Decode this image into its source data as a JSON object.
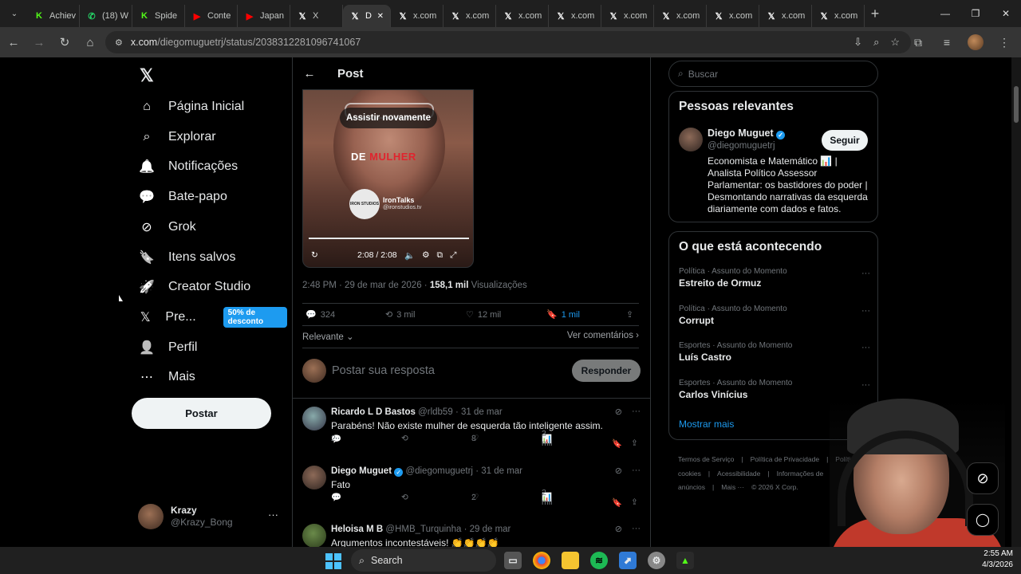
{
  "browser": {
    "tabs": [
      {
        "label": "Achiev",
        "fav": "K",
        "fav_color": "#53fc18"
      },
      {
        "label": "(18) W",
        "fav": "✆",
        "fav_color": "#25d366"
      },
      {
        "label": "Spide",
        "fav": "K",
        "fav_color": "#53fc18"
      },
      {
        "label": "Conte",
        "fav": "▶",
        "fav_color": "#ff0000"
      },
      {
        "label": "Japan",
        "fav": "▶",
        "fav_color": "#ff0000"
      },
      {
        "label": "X",
        "fav": "𝕏",
        "fav_color": "#ffffff"
      },
      {
        "label": "D",
        "fav": "𝕏",
        "fav_color": "#ffffff",
        "active": true
      },
      {
        "label": "x.com",
        "fav": "𝕏",
        "fav_color": "#ffffff"
      },
      {
        "label": "x.com",
        "fav": "𝕏",
        "fav_color": "#ffffff"
      },
      {
        "label": "x.com",
        "fav": "𝕏",
        "fav_color": "#ffffff"
      },
      {
        "label": "x.com",
        "fav": "𝕏",
        "fav_color": "#ffffff"
      },
      {
        "label": "x.com",
        "fav": "𝕏",
        "fav_color": "#ffffff"
      },
      {
        "label": "x.com",
        "fav": "𝕏",
        "fav_color": "#ffffff"
      },
      {
        "label": "x.com",
        "fav": "𝕏",
        "fav_color": "#ffffff"
      },
      {
        "label": "x.com",
        "fav": "𝕏",
        "fav_color": "#ffffff"
      },
      {
        "label": "x.com",
        "fav": "𝕏",
        "fav_color": "#ffffff"
      }
    ],
    "url_host": "x.com",
    "url_path": "/diegomuguetrj/status/2038312281096741067"
  },
  "sidebar": {
    "items": [
      {
        "label": "Página Inicial",
        "icon": "home-icon"
      },
      {
        "label": "Explorar",
        "icon": "search-icon"
      },
      {
        "label": "Notificações",
        "icon": "bell-icon"
      },
      {
        "label": "Bate-papo",
        "icon": "chat-icon"
      },
      {
        "label": "Grok",
        "icon": "grok-icon"
      },
      {
        "label": "Itens salvos",
        "icon": "bookmark-icon"
      },
      {
        "label": "Creator Studio",
        "icon": "rocket-icon"
      },
      {
        "label": "Pre...",
        "icon": "x-logo-icon"
      },
      {
        "label": "Perfil",
        "icon": "person-icon"
      },
      {
        "label": "Mais",
        "icon": "more-circle-icon"
      }
    ],
    "premium_badge": "50% de desconto",
    "post_button": "Postar",
    "account": {
      "name": "Krazy",
      "handle": "@Krazy_Bong"
    }
  },
  "post": {
    "header_title": "Post",
    "video": {
      "replay_label": "Assistir novamente",
      "caption_white": "DE ",
      "caption_red": "MULHER",
      "brand_name": "IronTalks",
      "brand_handle": "@ironstudios.tv",
      "brand_logo_text": "IRON STUDIOS",
      "time": "2:08 / 2:08",
      "progress": 1.0
    },
    "timestamp": "2:48 PM · 29 de mar de 2026 · ",
    "views_count": "158,1 mil",
    "views_label": " Visualizações",
    "stats": {
      "replies": "324",
      "reposts": "3 mil",
      "likes": "12 mil",
      "bookmarks": "1 mil"
    },
    "sort_label": "Relevante",
    "see_comments": "Ver comentários",
    "reply_placeholder": "Postar sua resposta",
    "reply_button": "Responder"
  },
  "replies": [
    {
      "name": "Ricardo L D Bastos",
      "handle": "@rldb59",
      "date": "· 31 de mar",
      "verified": false,
      "text": "Parabéns! Não existe mulher de esquerda tão inteligente assim.",
      "replies": "2",
      "reposts": "",
      "likes": "8",
      "views": "3 mil"
    },
    {
      "name": "Diego Muguet",
      "handle": "@diegomuguetrj",
      "date": "· 31 de mar",
      "verified": true,
      "text": "Fato",
      "replies": "",
      "reposts": "",
      "likes": "2",
      "views": "2 mil"
    },
    {
      "name": "Heloisa M B",
      "handle": "@HMB_Turquinha",
      "date": "· 29 de mar",
      "verified": false,
      "text": "Argumentos incontestáveis! 👏👏👏👏",
      "replies": "",
      "reposts": "",
      "likes": "",
      "views": ""
    }
  ],
  "right": {
    "search_placeholder": "Buscar",
    "relevant_title": "Pessoas relevantes",
    "person": {
      "name": "Diego Muguet",
      "handle": "@diegomuguetrj",
      "follow": "Seguir",
      "bio": "Economista e Matemático 📊 | Analista Político Assessor Parlamentar: os bastidores do poder | Desmontando narrativas da esquerda diariamente com dados e fatos."
    },
    "trends_title": "O que está acontecendo",
    "trends": [
      {
        "context": "Política · Assunto do Momento",
        "topic": "Estreito de Ormuz"
      },
      {
        "context": "Política · Assunto do Momento",
        "topic": "Corrupt"
      },
      {
        "context": "Esportes · Assunto do Momento",
        "topic": "Luís Castro"
      },
      {
        "context": "Esportes · Assunto do Momento",
        "topic": "Carlos Vinícius"
      }
    ],
    "show_more": "Mostrar mais",
    "footer": [
      "Termos de Serviço",
      "|",
      "Política de Privacidade",
      "|",
      "Política de cookies",
      "|",
      "Acessibilidade",
      "|",
      "Informações de anúncios",
      "|",
      "Mais ···",
      "© 2026 X Corp."
    ]
  },
  "taskbar": {
    "search_label": "Search",
    "time": "2:55 AM",
    "date": "4/3/2026"
  },
  "colors": {
    "accent": "#1d9bf0",
    "background": "#000000",
    "border": "#2f3336",
    "muted": "#71767b"
  }
}
